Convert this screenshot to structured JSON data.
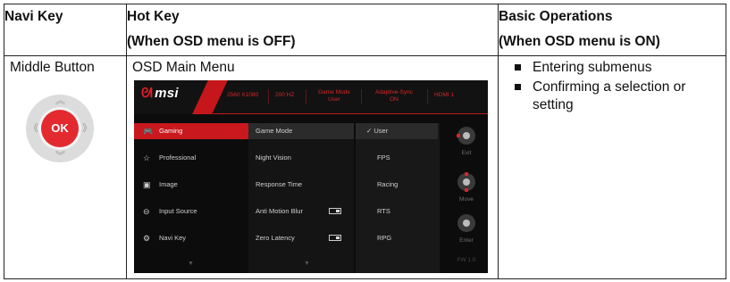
{
  "table": {
    "headers": {
      "navi_key": "Navi Key",
      "hot_key_line1": "Hot Key",
      "hot_key_line2": "(When OSD menu is OFF)",
      "basic_ops_line1": "Basic Operations",
      "basic_ops_line2": "(When OSD menu is ON)"
    },
    "row": {
      "navi_label": "Middle Button",
      "ok_label": "OK",
      "hot_key_label": "OSD Main Menu",
      "operations": [
        "Entering submenus",
        "Confirming a selection or setting"
      ]
    }
  },
  "osd": {
    "logo": "msi",
    "status": [
      "2560 X1080",
      "200 HZ",
      "Game Mode",
      "User",
      "Adaptive-Sync",
      "ON",
      "HDMI 1"
    ],
    "menu": [
      {
        "label": "Gaming",
        "icon": "gamepad-icon",
        "glyph": "🎮"
      },
      {
        "label": "Professional",
        "icon": "star-icon",
        "glyph": "☆"
      },
      {
        "label": "Image",
        "icon": "image-icon",
        "glyph": "▣"
      },
      {
        "label": "Input Source",
        "icon": "input-icon",
        "glyph": "⊖"
      },
      {
        "label": "Navi Key",
        "icon": "navi-key-icon",
        "glyph": "⚙"
      }
    ],
    "submenu": [
      "Game Mode",
      "Night Vision",
      "Response Time",
      "Anti Motion Blur",
      "Zero Latency"
    ],
    "options": [
      "User",
      "FPS",
      "Racing",
      "RTS",
      "RPG"
    ],
    "controls": [
      "Exit",
      "Move",
      "Enter"
    ],
    "firmware": "FW 1.0",
    "colors": {
      "accent": "#c9181e",
      "background": "#0c0c0c"
    }
  }
}
